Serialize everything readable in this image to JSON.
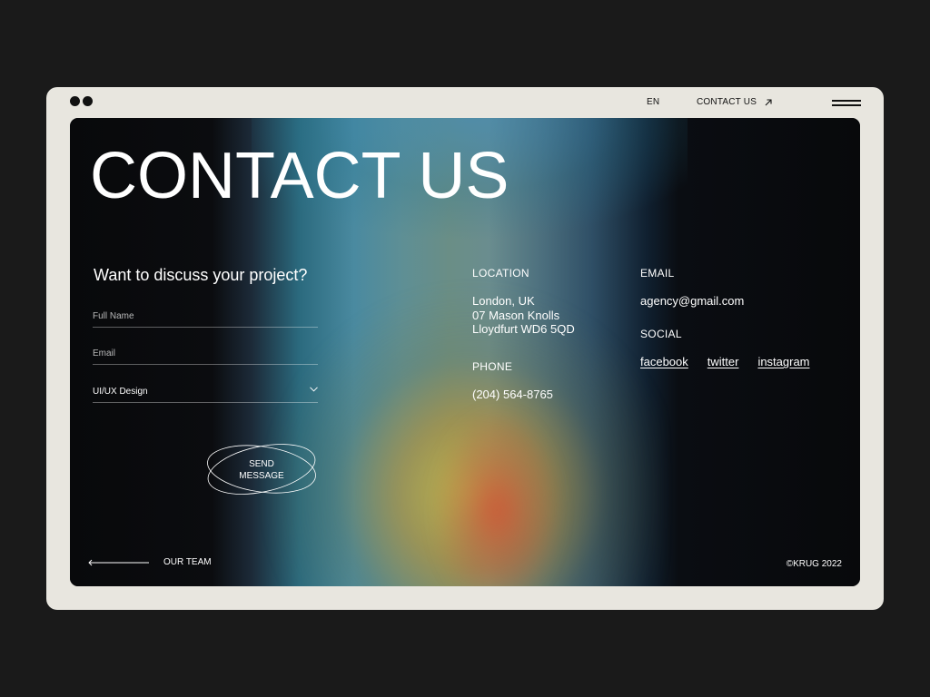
{
  "topbar": {
    "lang": "EN",
    "contact_link": "CONTACT US",
    "icons": {
      "arrow": "arrow-up-right-icon",
      "menu": "hamburger-menu-icon"
    }
  },
  "hero": {
    "title": "CONTACT US"
  },
  "form": {
    "heading": "Want to discuss your project?",
    "full_name_placeholder": "Full Name",
    "email_placeholder": "Email",
    "service_selected": "UI/UX Design",
    "send_label_line1": "SEND",
    "send_label_line2": "MESSAGE"
  },
  "location": {
    "heading": "LOCATION",
    "line1": "London, UK",
    "line2": "07 Mason Knolls",
    "line3": "Lloydfurt WD6 5QD"
  },
  "phone": {
    "heading": "PHONE",
    "number": "(204) 564-8765"
  },
  "email": {
    "heading": "EMAIL",
    "address": "agency@gmail.com"
  },
  "social": {
    "heading": "SOCIAL",
    "links": [
      "facebook",
      "twitter",
      "instagram"
    ]
  },
  "footer": {
    "team_link": "OUR TEAM",
    "copyright": "©KRUG 2022"
  },
  "colors": {
    "page_bg": "#1a1a1a",
    "frame_bg": "#e8e6df",
    "hero_bg": "#0a0a0c",
    "text_light": "#ffffff"
  }
}
